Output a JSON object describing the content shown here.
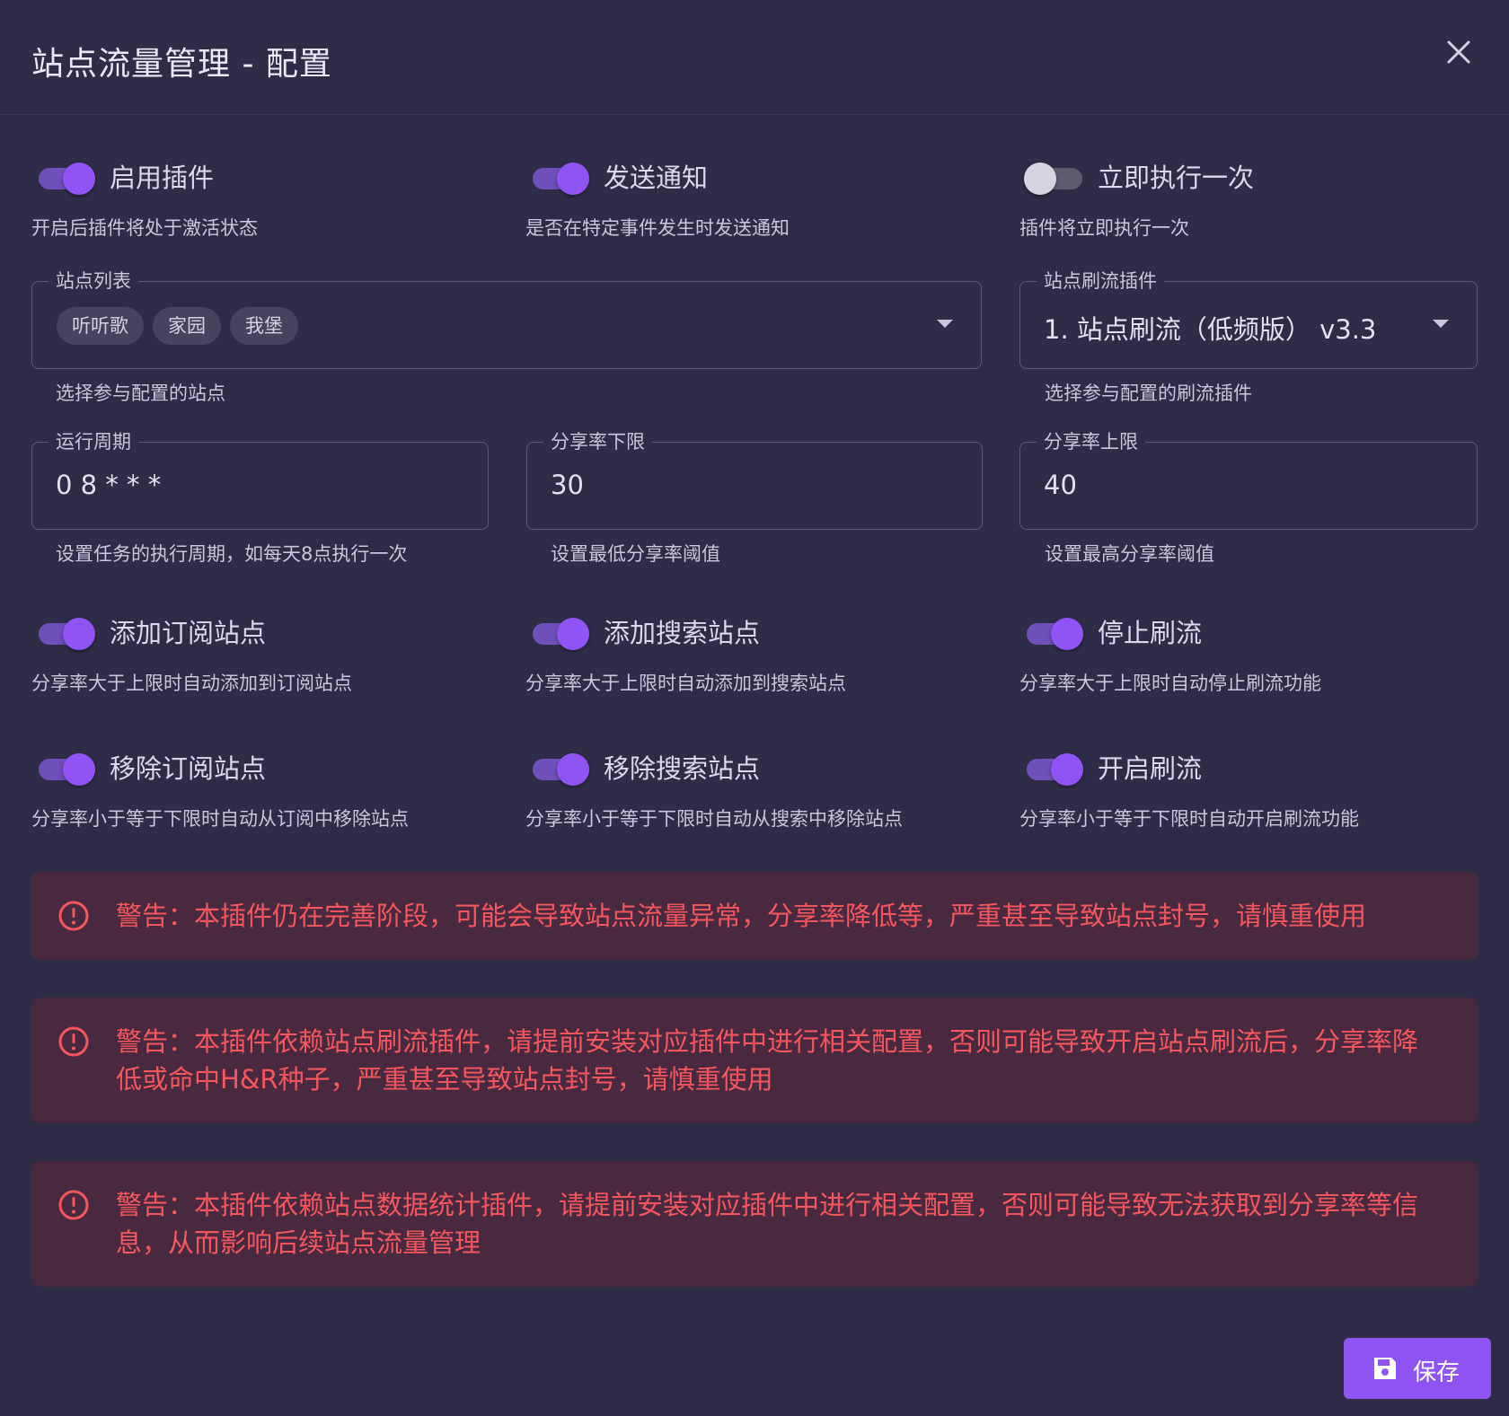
{
  "dialog": {
    "title": "站点流量管理 - 配置"
  },
  "toggles_row1": [
    {
      "label": "启用插件",
      "hint": "开启后插件将处于激活状态",
      "on": true
    },
    {
      "label": "发送通知",
      "hint": "是否在特定事件发生时发送通知",
      "on": true
    },
    {
      "label": "立即执行一次",
      "hint": "插件将立即执行一次",
      "on": false
    }
  ],
  "site_list": {
    "label": "站点列表",
    "chips": [
      "听听歌",
      "家园",
      "我堡"
    ],
    "hint": "选择参与配置的站点"
  },
  "brush_plugin": {
    "label": "站点刷流插件",
    "value": "1. 站点刷流（低频版） v3.3",
    "hint": "选择参与配置的刷流插件"
  },
  "cron": {
    "label": "运行周期",
    "value": "0 8 * * *",
    "hint": "设置任务的执行周期，如每天8点执行一次"
  },
  "ratio_low": {
    "label": "分享率下限",
    "value": "30",
    "hint": "设置最低分享率阈值"
  },
  "ratio_high": {
    "label": "分享率上限",
    "value": "40",
    "hint": "设置最高分享率阈值"
  },
  "toggles_row2": [
    {
      "label": "添加订阅站点",
      "hint": "分享率大于上限时自动添加到订阅站点",
      "on": true
    },
    {
      "label": "添加搜索站点",
      "hint": "分享率大于上限时自动添加到搜索站点",
      "on": true
    },
    {
      "label": "停止刷流",
      "hint": "分享率大于上限时自动停止刷流功能",
      "on": true
    }
  ],
  "toggles_row3": [
    {
      "label": "移除订阅站点",
      "hint": "分享率小于等于下限时自动从订阅中移除站点",
      "on": true
    },
    {
      "label": "移除搜索站点",
      "hint": "分享率小于等于下限时自动从搜索中移除站点",
      "on": true
    },
    {
      "label": "开启刷流",
      "hint": "分享率小于等于下限时自动开启刷流功能",
      "on": true
    }
  ],
  "alerts": [
    "警告：本插件仍在完善阶段，可能会导致站点流量异常，分享率降低等，严重甚至导致站点封号，请慎重使用",
    "警告：本插件依赖站点刷流插件，请提前安装对应插件中进行相关配置，否则可能导致开启站点刷流后，分享率降低或命中H&R种子，严重甚至导致站点封号，请慎重使用",
    "警告：本插件依赖站点数据统计插件，请提前安装对应插件中进行相关配置，否则可能导致无法获取到分享率等信息，从而影响后续站点流量管理"
  ],
  "save_label": "保存",
  "colors": {
    "background": "#2f2c48",
    "accent": "#9054f5",
    "alert_bg": "#48293f",
    "alert_text": "#f6575e"
  },
  "icons": {
    "close": "close-icon",
    "alert": "alert-circle-icon",
    "save": "floppy-disk-icon",
    "caret": "caret-down-icon"
  }
}
